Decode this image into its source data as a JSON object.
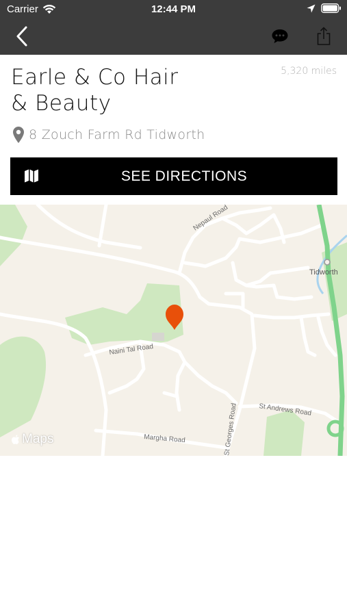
{
  "status_bar": {
    "carrier": "Carrier",
    "time": "12:44 PM"
  },
  "nav": {
    "back_icon": "chevron-left-icon",
    "actions": [
      "chat-bubble-icon",
      "share-icon"
    ]
  },
  "business": {
    "name_line1": "Earle & Co Hair",
    "name_line2": "& Beauty",
    "distance": "5,320 miles",
    "address": "8 Zouch Farm Rd Tidworth"
  },
  "directions_button": {
    "label": "SEE DIRECTIONS",
    "icon": "map-icon"
  },
  "map": {
    "logo_text": "Maps",
    "pin_color": "#e8500a",
    "labels": {
      "nepaul_road": "Nepaul Road",
      "tidworth": "Tidworth",
      "naini_tal_road": "Naini Tal Road",
      "st_andrews_road": "St Andrews Road",
      "margha_road": "Margha Road",
      "st_georges_road": "St Georges Road"
    }
  },
  "colors": {
    "header_bg": "#3c3c3c",
    "button_bg": "#000000",
    "map_land": "#f5f1e9",
    "map_green": "#cfe8c0",
    "major_road": "#7fd38b"
  }
}
